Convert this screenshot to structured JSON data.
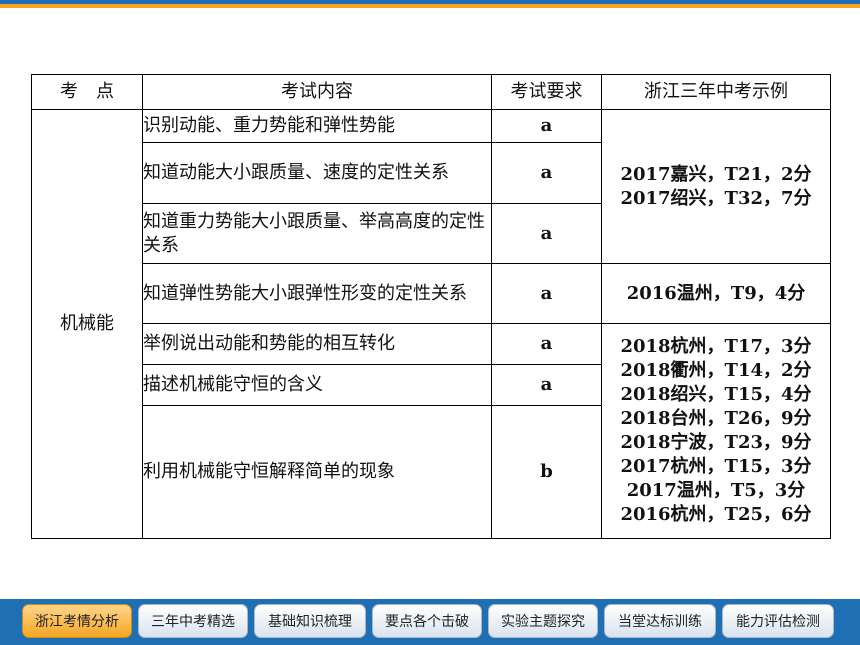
{
  "table": {
    "headers": [
      "考　点",
      "考试内容",
      "考试要求",
      "浙江三年中考示例"
    ],
    "topic": "机械能",
    "rows": [
      {
        "content": "识别动能、重力势能和弹性势能",
        "req": "a"
      },
      {
        "content": "知道动能大小跟质量、速度的定性关系",
        "req": "a"
      },
      {
        "content": "知道重力势能大小跟质量、举高高度的定性关系",
        "req": "a"
      },
      {
        "content": "知道弹性势能大小跟弹性形变的定性关系",
        "req": "a"
      },
      {
        "content": "举例说出动能和势能的相互转化",
        "req": "a"
      },
      {
        "content": "描述机械能守恒的含义",
        "req": "a"
      },
      {
        "content": "利用机械能守恒解释简单的现象",
        "req": "b"
      }
    ],
    "examples": [
      [
        "2017嘉兴，T21，2分",
        "2017绍兴，T32，7分"
      ],
      [
        "2016温州，T9，4分"
      ],
      [
        "2018杭州，T17，3分",
        "2018衢州，T14，2分",
        "2018绍兴，T15，4分",
        "2018台州，T26，9分",
        "2018宁波，T23，9分",
        "2017杭州，T15，3分",
        "2017温州，T5，3分",
        "2016杭州，T25，6分"
      ]
    ]
  },
  "nav": {
    "tabs": [
      "浙江考情分析",
      "三年中考精选",
      "基础知识梳理",
      "要点各个击破",
      "实验主题探究",
      "当堂达标训练",
      "能力评估检测"
    ],
    "active_tab": "浙江考情分析"
  },
  "colors": {
    "nav_bg": "#1f6fb5",
    "accent_orange": "#f5a623"
  }
}
